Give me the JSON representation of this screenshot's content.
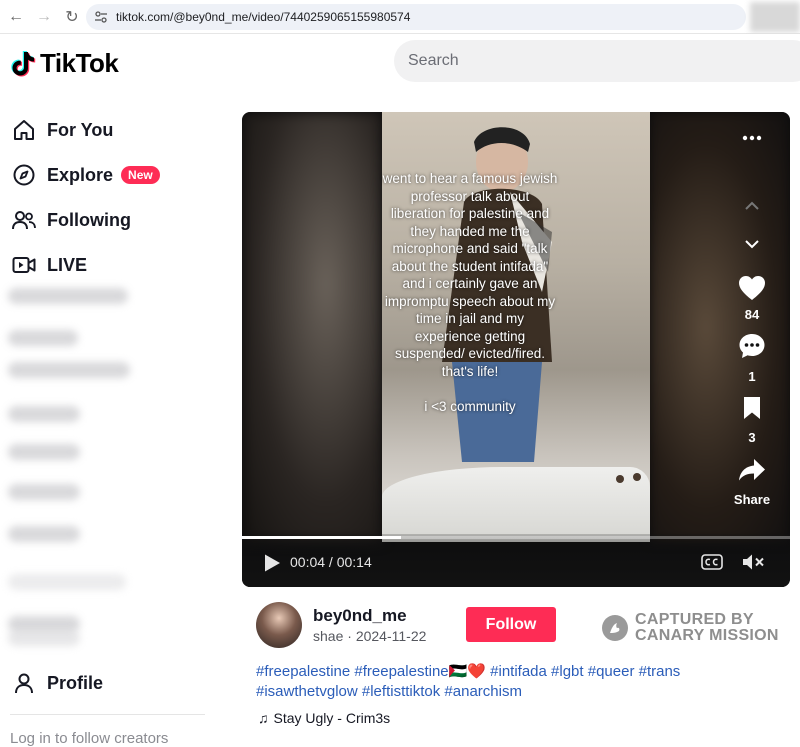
{
  "browser": {
    "url": "tiktok.com/@bey0nd_me/video/7440259065155980574"
  },
  "header": {
    "logo_text": "TikTok",
    "search_placeholder": "Search"
  },
  "sidebar": {
    "items": [
      {
        "label": "For You",
        "icon": "home-icon"
      },
      {
        "label": "Explore",
        "icon": "compass-icon",
        "badge": "New"
      },
      {
        "label": "Following",
        "icon": "following-icon"
      },
      {
        "label": "LIVE",
        "icon": "live-icon"
      }
    ],
    "profile_label": "Profile",
    "footer_text": "Log in to follow creators"
  },
  "video": {
    "caption": "went to hear a famous jewish professor talk about liberation for palestine and they handed me the microphone and said \"talk about the student intifada\" and i certainly gave an impromptu speech about my time in jail and my experience getting suspended/ evicted/fired. that's life!\n\ni <3 community",
    "likes": "84",
    "comments": "1",
    "saves": "3",
    "share_label": "Share",
    "time": "00:04 / 00:14",
    "progress_fraction": 0.29
  },
  "post": {
    "username": "bey0nd_me",
    "display_name": "shae",
    "date": "2024-11-22",
    "follow_label": "Follow",
    "watermark_line1": "CAPTURED BY",
    "watermark_line2": "CANARY MISSION",
    "hashtags_line1": "#freepalestine #freepalestine🇵🇸❤️ #intifada #lgbt #queer #trans",
    "hashtags_line2": "#isawthetvglow #leftisttiktok #anarchism",
    "music": "Stay Ugly - Crim3s"
  },
  "colors": {
    "accent": "#fe2c55",
    "hashtag": "#2b5db9"
  }
}
